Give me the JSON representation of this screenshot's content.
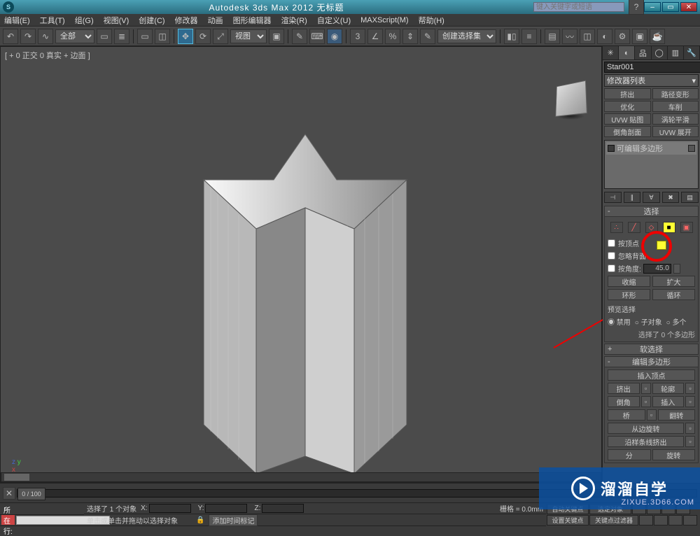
{
  "title": "Autodesk 3ds Max  2012      无标题",
  "search_placeholder": "键入关键字或短语",
  "menu": [
    "编辑(E)",
    "工具(T)",
    "组(G)",
    "视图(V)",
    "创建(C)",
    "修改器",
    "动画",
    "图形编辑器",
    "渲染(R)",
    "自定义(U)",
    "MAXScript(M)",
    "帮助(H)"
  ],
  "toolbar": {
    "all_label": "全部",
    "view_label": "视图",
    "create_set": "创建选择集"
  },
  "viewport_label": "[ + 0 正交 0 真实 + 边面 ]",
  "slider_label": "0 / 100",
  "panel": {
    "object_name": "Star001",
    "modlist": "修改器列表",
    "buttons": [
      "挤出",
      "路径变形",
      "优化",
      "车削",
      "UVW 贴图",
      "涡轮平滑",
      "倒角剖面",
      "UVW 展开"
    ],
    "stack_item": "可编辑多边形"
  },
  "selection": {
    "title": "选择",
    "by_vertex": "按顶点",
    "ignore_back": "忽略背面",
    "by_angle": "按角度:",
    "angle": "45.0",
    "shrink": "收缩",
    "grow": "扩大",
    "ring": "环形",
    "loop": "循环",
    "preview": "预览选择",
    "disable": "禁用",
    "subobj": "子对象",
    "multi": "多个",
    "info": "选择了 0 个多边形"
  },
  "softsel": "软选择",
  "editpoly": {
    "title": "编辑多边形",
    "insert_vertex": "插入顶点",
    "extrude": "挤出",
    "outline": "轮廓",
    "bevel": "倒角",
    "inset": "插入",
    "bridge": "桥",
    "flip": "翻转",
    "hinge": "从边旋转",
    "extrude_spline": "沿样条线挤出",
    "split": "分",
    "rotate": "旋转"
  },
  "status": {
    "sel_count": "选择了 1 个对象",
    "hint": "单击或单击并拖动以选择对象",
    "tag": "所在行:",
    "lock": "添加时间标记",
    "grid": "栅格 = 0.0mm",
    "autokey": "自动关键点",
    "selset": "选定对象",
    "setkey": "设置关键点",
    "keyfilter": "关键点过滤器"
  },
  "watermark": {
    "brand": "溜溜自学",
    "url": "ZIXUE.3D66.COM"
  }
}
